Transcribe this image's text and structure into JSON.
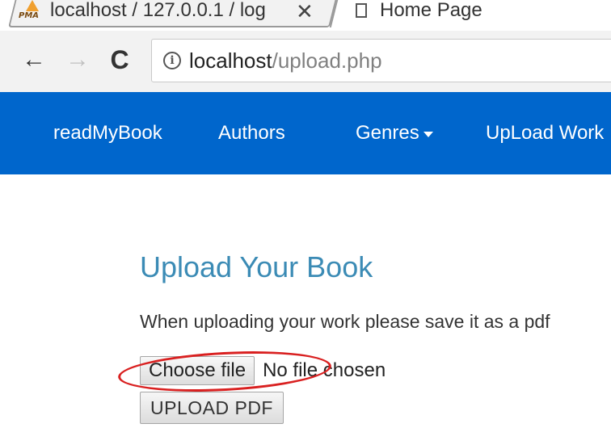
{
  "browser": {
    "tabs": [
      {
        "title": "localhost / 127.0.0.1 / log",
        "favicon_text": "PMA",
        "close_glyph": "✕"
      },
      {
        "title": "Home Page"
      }
    ],
    "toolbar": {
      "back_glyph": "←",
      "forward_glyph": "→",
      "reload_glyph": "C",
      "info_glyph": "i"
    },
    "address": {
      "host": "localhost",
      "path": "/upload.php"
    }
  },
  "navbar": {
    "brand": "readMyBook",
    "items": [
      {
        "label": "Authors"
      },
      {
        "label": "Genres"
      },
      {
        "label": "UpLoad Work"
      }
    ]
  },
  "main": {
    "title": "Upload Your Book",
    "description": "When uploading your work please save it as a pdf",
    "file_input": {
      "button_label": "Choose file",
      "status": "No file chosen"
    },
    "upload_button": "UPLOAD PDF"
  },
  "colors": {
    "navbar_bg": "#0066cc",
    "title_color": "#3b8bb5",
    "highlight": "#d92020"
  },
  "icons": {
    "favicon": "phpmyadmin-icon",
    "page": "page-icon",
    "back": "arrow-left-icon",
    "forward": "arrow-right-icon",
    "reload": "reload-icon",
    "info": "info-icon",
    "dropdown": "caret-down-icon"
  }
}
